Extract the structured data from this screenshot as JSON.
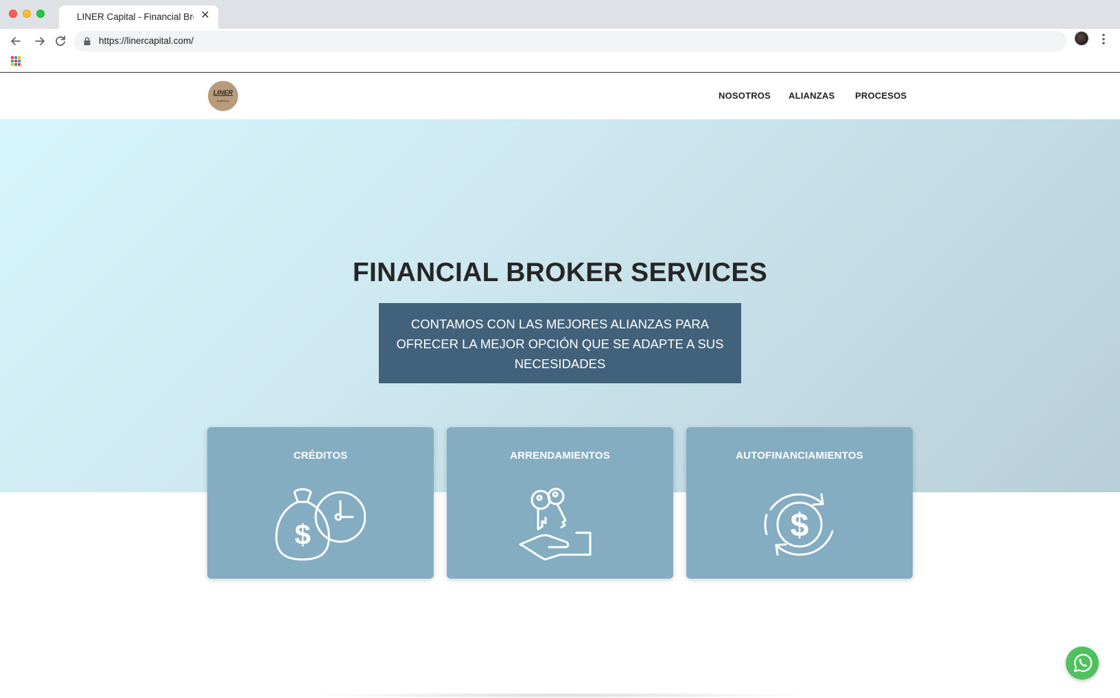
{
  "browser": {
    "tab_title": "LINER Capital - Financial Brok",
    "tab_close": "✕",
    "url": "https://linercapital.com/"
  },
  "site": {
    "logo_text": "LINER",
    "logo_subtext": "CAPITAL",
    "nav": [
      "NOSOTROS",
      "ALIANZAS",
      "PROCESOS"
    ]
  },
  "hero": {
    "title": "FINANCIAL BROKER SERVICES",
    "subtitle": "CONTAMOS CON LAS MEJORES ALIANZAS PARA OFRECER LA MEJOR OPCIÓN QUE SE ADAPTE A SUS NECESIDADES"
  },
  "cards": [
    {
      "title": "CRÉDITOS",
      "icon": "money-bag-clock-icon"
    },
    {
      "title": "ARRENDAMIENTOS",
      "icon": "keys-hand-icon"
    },
    {
      "title": "AUTOFINANCIAMIENTOS",
      "icon": "dollar-cycle-icon"
    }
  ],
  "colors": {
    "hero_box": "#41627a",
    "card": "#84adc2",
    "whatsapp": "#4fc15e",
    "logo": "#b89b7a"
  }
}
